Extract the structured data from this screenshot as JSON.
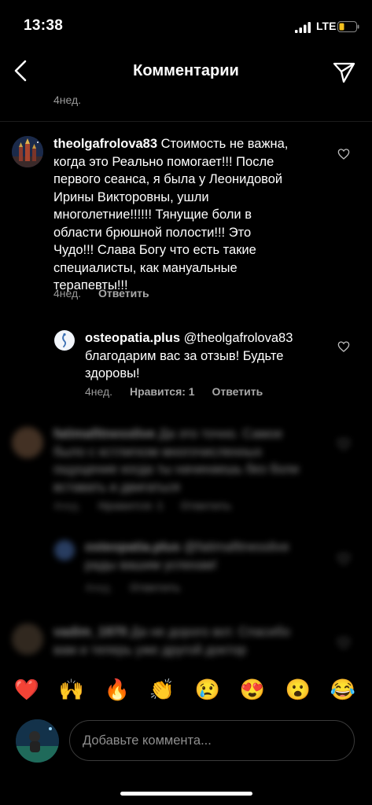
{
  "status_bar": {
    "time": "13:38",
    "network": "LTE"
  },
  "header": {
    "title": "Комментарии"
  },
  "prev_comment": {
    "time": "4нед."
  },
  "comment": {
    "username": "theolgafrolova83",
    "lines": [
      "Стоимость не важна,",
      "когда это Реально помогает!!! После",
      "первого сеанса, я была у Леонидовой",
      "Ирины Викторовны, ушли",
      "многолетние!!!!!! Тянущие боли в",
      "области брюшной полости!!! Это",
      "Чудо!!! Слава Богу что есть такие",
      "специалисты, как мануальные",
      "терапевты!!!"
    ],
    "time": "4нед.",
    "reply_label": "Ответить"
  },
  "reply": {
    "username": "osteopatia.plus",
    "mention": "@theolgafrolova83",
    "lines": [
      "благодарим вас за отзыв! Будьте",
      "здоровы!"
    ],
    "time": "4нед.",
    "likes": "Нравится: 1",
    "reply_label": "Ответить"
  },
  "blurred": {
    "c1_user": "fatimafitnesslive",
    "c1_lines": [
      "Да это точно. Самое",
      "было с кстлигком многочисленных",
      "ощущение когда ты начинаешь без боли",
      "вставать и двигаться"
    ],
    "c1_time": "4нед.",
    "c1_likes": "Нравится: 1",
    "c1_reply": "Ответить",
    "r1_user": "osteopatia.plus",
    "r1_lines": [
      "@fatimafitnesslive",
      "рады вашим успехам!"
    ],
    "r1_time": "4нед.",
    "r1_reply": "Ответить",
    "c2_user": "vadim_1970",
    "c2_lines": [
      "Да не дорого вот. Спасибо",
      "вам и теперь уже другой доктор"
    ]
  },
  "emojis": [
    "❤️",
    "🙌",
    "🔥",
    "👏",
    "😢",
    "😍",
    "😮",
    "😂"
  ],
  "input": {
    "placeholder": "Добавьте коммента..."
  }
}
